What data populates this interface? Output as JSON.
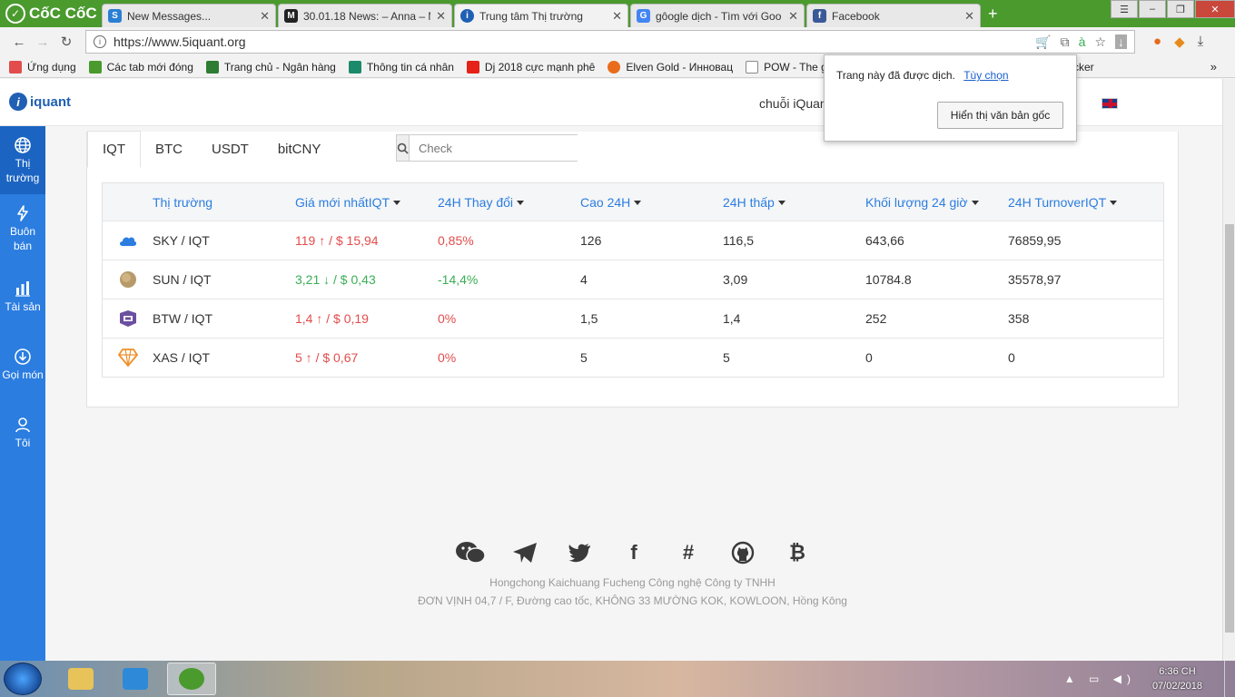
{
  "browser": {
    "name": "CốC CốC",
    "tabs": [
      {
        "title": "New Messages...",
        "favicon_color": "#2a7fd4",
        "favicon": "S"
      },
      {
        "title": "30.01.18 News: – Anna – M",
        "favicon_color": "#222222",
        "favicon": "M"
      },
      {
        "title": "Trung tâm Thị trường",
        "favicon_color": "#1f5fb4",
        "favicon": "i",
        "active": true
      },
      {
        "title": "gôogle dịch - Tìm với Goo",
        "favicon_color": "#4285f4",
        "favicon": "G"
      },
      {
        "title": "Facebook",
        "favicon_color": "#3b5998",
        "favicon": "f"
      }
    ],
    "url": "https://www.5iquant.org",
    "bookmarks": [
      {
        "label": "Ứng dụng",
        "color": "#e24c4c"
      },
      {
        "label": "Các tab mới đóng",
        "color": "#4a9a2e"
      },
      {
        "label": "Trang chủ - Ngân hàng",
        "color": "#2e7d32"
      },
      {
        "label": "Thông tin cá nhân",
        "color": "#1b8a6b"
      },
      {
        "label": "Dj 2018 cực mạnh phê",
        "color": "#e62117"
      },
      {
        "label": "Elven Gold - Инновац",
        "color": "#e86c1b"
      },
      {
        "label": "POW - The gl",
        "color": "#888888"
      },
      {
        "label": "cker",
        "color": "#888888"
      }
    ]
  },
  "translate_popup": {
    "message": "Trang này đã được dịch.",
    "options_link": "Tùy chọn",
    "show_original_button": "Hiển thị văn bản gốc"
  },
  "header": {
    "brand": "iquant",
    "nav_link": "chuỗi iQuan"
  },
  "sidebar": [
    {
      "label": "Thị trường",
      "icon": "globe-icon"
    },
    {
      "label": "Buôn bán",
      "icon": "lightning-icon"
    },
    {
      "label": "Tài sản",
      "icon": "bar-chart-icon"
    },
    {
      "label": "Gọi món",
      "icon": "download-circle-icon"
    },
    {
      "label": "Tôi",
      "icon": "user-icon"
    }
  ],
  "market": {
    "tabs": [
      "IQT",
      "BTC",
      "USDT",
      "bitCNY"
    ],
    "search_placeholder": "Check",
    "columns": [
      "Thị trường",
      "Giá mới nhấtIQT",
      "24H Thay đổi",
      "Cao 24H",
      "24H thấp",
      "Khối lượng 24 giờ",
      "24H TurnoverIQT"
    ],
    "rows": [
      {
        "pair": "SKY / IQT",
        "price": "119 ↑ / $ 15,94",
        "trend": "up",
        "change": "0,85%",
        "high": "126",
        "low": "116,5",
        "volume": "643,66",
        "turnover": "76859,95",
        "icon_color": "#2b7de0"
      },
      {
        "pair": "SUN / IQT",
        "price": "3,21 ↓ / $ 0,43",
        "trend": "down",
        "change": "-14,4%",
        "high": "4",
        "low": "3,09",
        "volume": "10784.8",
        "turnover": "35578,97",
        "icon_color": "#b79a6a"
      },
      {
        "pair": "BTW / IQT",
        "price": "1,4 ↑ / $ 0,19",
        "trend": "up",
        "change": "0%",
        "high": "1,5",
        "low": "1,4",
        "volume": "252",
        "turnover": "358",
        "icon_color": "#6b4fa0"
      },
      {
        "pair": "XAS / IQT",
        "price": "5 ↑ / $ 0,67",
        "trend": "up",
        "change": "0%",
        "high": "5",
        "low": "5",
        "volume": "0",
        "turnover": "0",
        "icon_color": "#f0902a"
      }
    ]
  },
  "footer": {
    "icons": [
      "wechat-icon",
      "telegram-icon",
      "twitter-icon",
      "facebook-icon",
      "slack-icon",
      "github-icon",
      "bitcoin-icon"
    ],
    "company": "Hongchong Kaichuang Fucheng Công nghệ Công ty TNHH",
    "address": "ĐƠN VỊNH 04,7 / F, Đường cao tốc, KHÔNG 33 MƯỜNG KOK, KOWLOON, Hồng Kông"
  },
  "taskbar": {
    "time": "6:36 CH",
    "date": "07/02/2018"
  },
  "colors": {
    "accent": "#2b7de0",
    "price_up": "#e24c4c",
    "price_down": "#3aae55",
    "browser_green": "#4a9a2e"
  }
}
